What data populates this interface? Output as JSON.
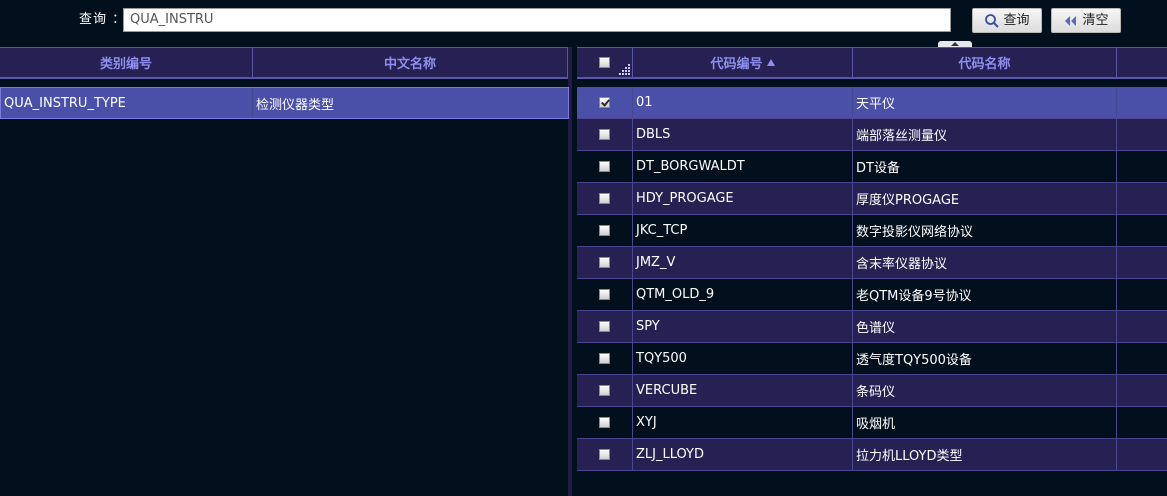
{
  "search": {
    "label": "查询 ：",
    "value": "QUA_INSTRU",
    "query_button": "查询",
    "clear_button": "清空"
  },
  "left_table": {
    "columns": [
      "类别编号",
      "中文名称"
    ],
    "rows": [
      {
        "code": "QUA_INSTRU_TYPE",
        "name": "检测仪器类型",
        "selected": true
      }
    ]
  },
  "right_table": {
    "columns": [
      "代码编号",
      "代码名称"
    ],
    "sort_column": "代码编号",
    "sort_direction": "asc",
    "rows": [
      {
        "code": "01",
        "name": "天平仪",
        "checked": true
      },
      {
        "code": "DBLS",
        "name": "端部落丝测量仪",
        "checked": false
      },
      {
        "code": "DT_BORGWALDT",
        "name": "DT设备",
        "checked": false
      },
      {
        "code": "HDY_PROGAGE",
        "name": "厚度仪PROGAGE",
        "checked": false
      },
      {
        "code": "JKC_TCP",
        "name": "数字投影仪网络协议",
        "checked": false
      },
      {
        "code": "JMZ_V",
        "name": "含末率仪器协议",
        "checked": false
      },
      {
        "code": "QTM_OLD_9",
        "name": "老QTM设备9号协议",
        "checked": false
      },
      {
        "code": "SPY",
        "name": "色谱仪",
        "checked": false
      },
      {
        "code": "TQY500",
        "name": "透气度TQY500设备",
        "checked": false
      },
      {
        "code": "VERCUBE",
        "name": "条码仪",
        "checked": false
      },
      {
        "code": "XYJ",
        "name": "吸烟机",
        "checked": false
      },
      {
        "code": "ZLJ_LLOYD",
        "name": "拉力机LLOYD类型",
        "checked": false
      }
    ]
  },
  "colors": {
    "background": "#020f1d",
    "header_bg": "#262152",
    "header_text": "#8e8ef0",
    "row_alt": "#262152",
    "row_selected": "#4a4fa8",
    "grid_line": "#4a4790"
  }
}
